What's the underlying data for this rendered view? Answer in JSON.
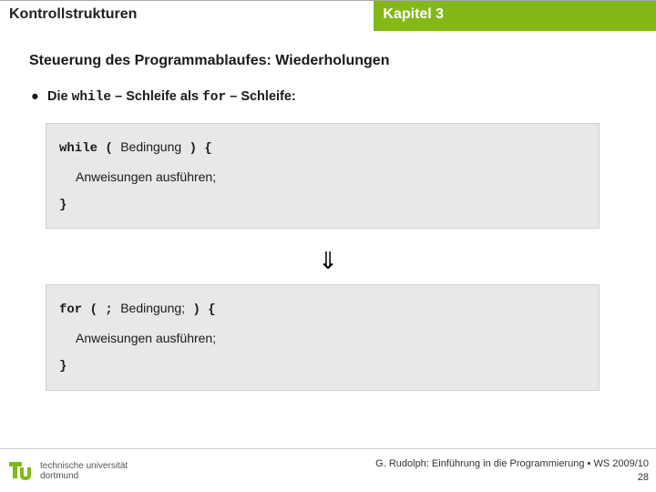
{
  "header": {
    "left": "Kontrollstrukturen",
    "right": "Kapitel 3"
  },
  "subtitle": "Steuerung des Programmablaufes: Wiederholungen",
  "bullet": {
    "prefix": "Die ",
    "kw1": "while",
    "mid1": " – Schleife als ",
    "kw2": "for",
    "mid2": " – Schleife:"
  },
  "code1": {
    "l1a": "while ( ",
    "l1b": "Bedingung",
    "l1c": " ) {",
    "l2": "Anweisungen ausführen;",
    "l3": "}"
  },
  "arrow": "⇓",
  "code2": {
    "l1a": "for ( ; ",
    "l1b": "Bedingung;",
    "l1c": " ) {",
    "l2": "Anweisungen ausführen;",
    "l3": "}"
  },
  "footer": {
    "uni1": "technische universität",
    "uni2": "dortmund",
    "credit": "G. Rudolph: Einführung in die Programmierung ▪ WS 2009/10",
    "page": "28"
  }
}
